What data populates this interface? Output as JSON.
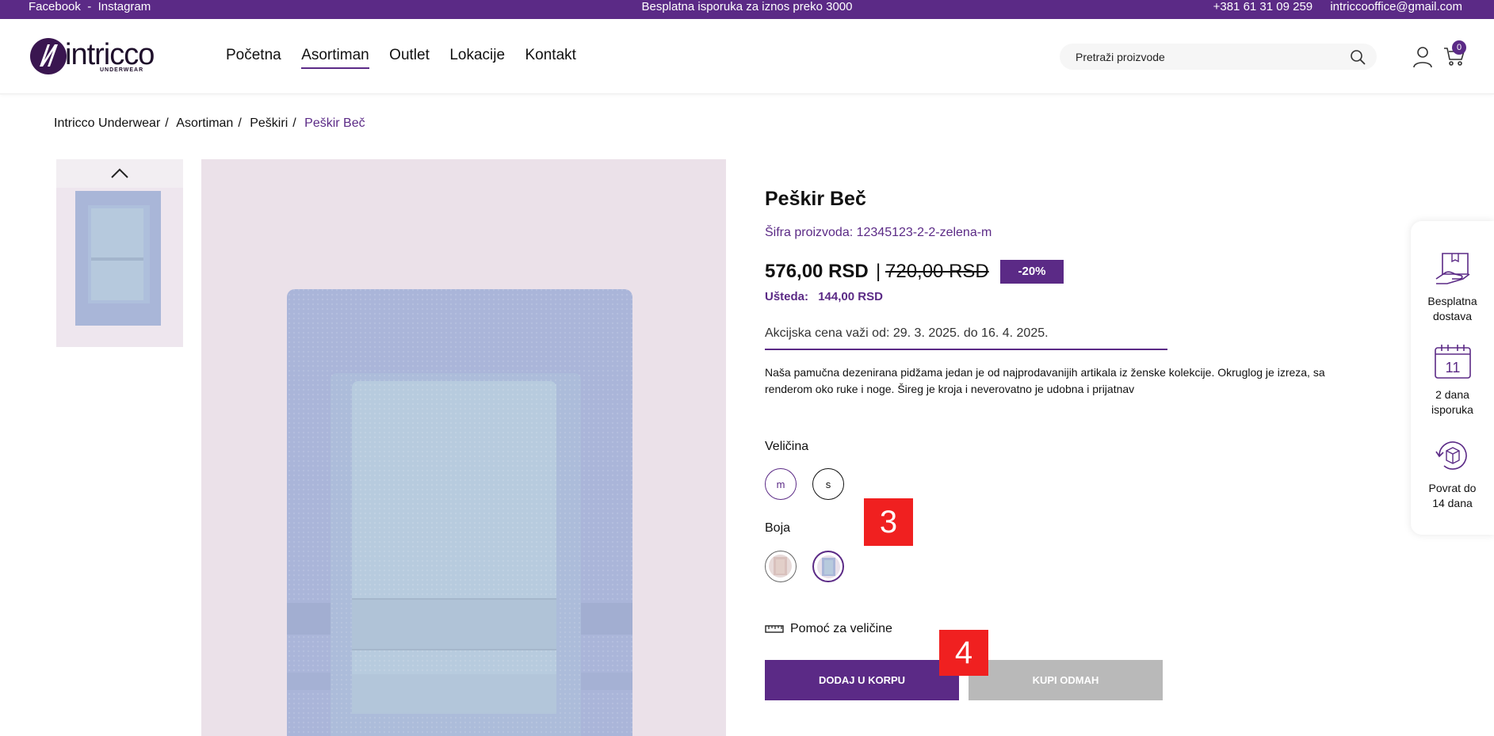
{
  "topbar": {
    "facebook": "Facebook",
    "separator": "-",
    "instagram": "Instagram",
    "promo": "Besplatna isporuka za iznos preko 3000",
    "phone": "+381 61 31 09 259",
    "email": "intriccooffice@gmail.com"
  },
  "header": {
    "logo_text": "intricco",
    "logo_sub": "UNDERWEAR",
    "nav": [
      "Početna",
      "Asortiman",
      "Outlet",
      "Lokacije",
      "Kontakt"
    ],
    "active_nav": "Asortiman",
    "search_placeholder": "Pretraži proizvode",
    "cart_count": "0"
  },
  "breadcrumb": {
    "items": [
      "Intricco Underwear",
      "Asortiman",
      "Peškiri"
    ],
    "current": "Peškir Beč"
  },
  "product": {
    "title": "Peškir Beč",
    "sku": "Šifra proizvoda: 12345123-2-2-zelena-m",
    "price": "576,00 RSD",
    "price_separator": "|",
    "old_price": "720,00 RSD",
    "discount": "-20%",
    "savings_label": "Ušteda:",
    "savings_value": "144,00 RSD",
    "promo_validity": "Akcijska cena važi od: 29. 3. 2025. do 16. 4. 2025.",
    "description": "Naša pamučna dezenirana pidžama jedan je od najprodavanijih artikala iz ženske kolekcije. Okruglog je izreza, sa renderom oko ruke i noge. Šireg je kroja i neverovatno je udobna i prijatnav",
    "size_label": "Veličina",
    "sizes": [
      "m",
      "s"
    ],
    "selected_size": "m",
    "color_label": "Boja",
    "colors": [
      {
        "name": "beige-swatch",
        "hex": "#e6d6d6"
      },
      {
        "name": "blue-swatch",
        "hex": "#b7c6de"
      }
    ],
    "selected_color": "blue-swatch",
    "size_help": "Pomoć za veličine",
    "add_to_cart": "DODAJ U KORPU",
    "buy_now": "KUPI ODMAH"
  },
  "markers": [
    "3",
    "4"
  ],
  "side_panel": [
    {
      "line1": "Besplatna",
      "line2": "dostava",
      "icon": "delivery-box-icon"
    },
    {
      "line1": "2 dana",
      "line2": "isporuka",
      "icon": "calendar-icon",
      "calendar_day": "11"
    },
    {
      "line1": "Povrat do",
      "line2": "14 dana",
      "icon": "return-box-icon"
    }
  ],
  "colors": {
    "brand": "#5b2a86",
    "marker": "#f02020",
    "disabled_button": "#b9b9b9"
  }
}
